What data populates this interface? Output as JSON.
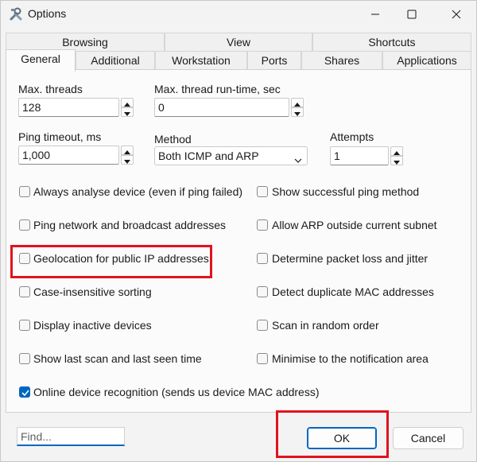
{
  "window": {
    "title": "Options"
  },
  "tabs_row1": [
    {
      "label": "Browsing"
    },
    {
      "label": "View"
    },
    {
      "label": "Shortcuts"
    }
  ],
  "tabs_row2": [
    {
      "label": "General",
      "active": true
    },
    {
      "label": "Additional"
    },
    {
      "label": "Workstation"
    },
    {
      "label": "Ports"
    },
    {
      "label": "Shares"
    },
    {
      "label": "Applications"
    }
  ],
  "fields": {
    "max_threads": {
      "label": "Max. threads",
      "value": "128"
    },
    "max_thread_runtime": {
      "label": "Max. thread run-time, sec",
      "value": "0"
    },
    "ping_timeout": {
      "label": "Ping timeout, ms",
      "value": "1,000"
    },
    "method": {
      "label": "Method",
      "value": "Both ICMP and ARP"
    },
    "attempts": {
      "label": "Attempts",
      "value": "1"
    }
  },
  "checkboxes_left": [
    {
      "label": "Always analyse device (even if ping failed)",
      "checked": false
    },
    {
      "label": "Ping network and broadcast addresses",
      "checked": false
    },
    {
      "label": "Geolocation for public IP addresses",
      "checked": false
    },
    {
      "label": "Case-insensitive sorting",
      "checked": false
    },
    {
      "label": "Display inactive devices",
      "checked": false
    },
    {
      "label": "Show last scan and last seen time",
      "checked": false
    }
  ],
  "checkboxes_right": [
    {
      "label": "Show successful ping method",
      "checked": false
    },
    {
      "label": "Allow ARP outside current subnet",
      "checked": false
    },
    {
      "label": "Determine packet loss and jitter",
      "checked": false
    },
    {
      "label": "Detect duplicate MAC addresses",
      "checked": false
    },
    {
      "label": "Scan in random order",
      "checked": false
    },
    {
      "label": "Minimise to the notification area",
      "checked": false
    }
  ],
  "online_recognition": {
    "label": "Online device recognition (sends us device MAC address)",
    "checked": true
  },
  "find": {
    "placeholder": "Find..."
  },
  "buttons": {
    "ok": "OK",
    "cancel": "Cancel"
  },
  "colors": {
    "accent": "#0067c0",
    "highlight": "#e0131e"
  },
  "icons": [
    "app-tools-icon",
    "minimize-icon",
    "maximize-icon",
    "close-icon",
    "spin-up-icon",
    "spin-down-icon",
    "chevron-down-icon",
    "checkmark-icon"
  ]
}
